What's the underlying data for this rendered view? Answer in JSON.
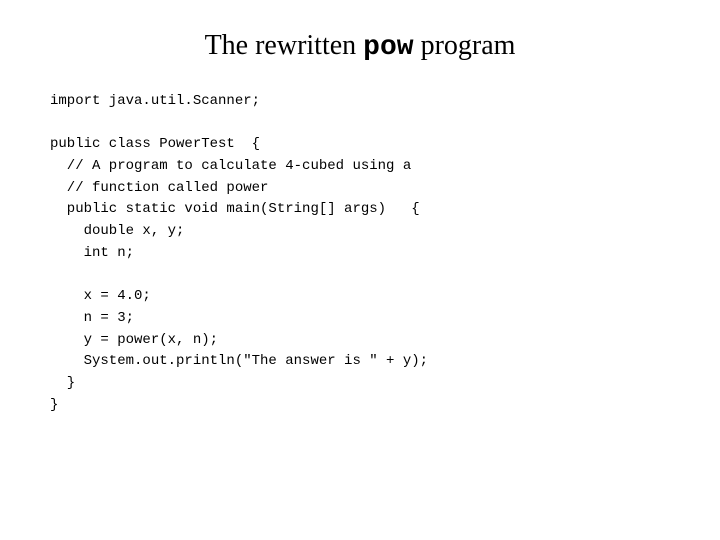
{
  "page": {
    "background": "#ffffff"
  },
  "title": {
    "prefix": "The rewritten ",
    "keyword": "pow",
    "suffix": " program"
  },
  "code": {
    "lines": [
      "import java.util.Scanner;",
      "",
      "public class PowerTest  {",
      "  // A program to calculate 4-cubed using a",
      "  // function called power",
      "  public static void main(String[] args)   {",
      "    double x, y;",
      "    int n;",
      "",
      "    x = 4.0;",
      "    n = 3;",
      "    y = power(x, n);",
      "    System.out.println(\"The answer is \" + y);",
      "  }",
      "}"
    ]
  }
}
